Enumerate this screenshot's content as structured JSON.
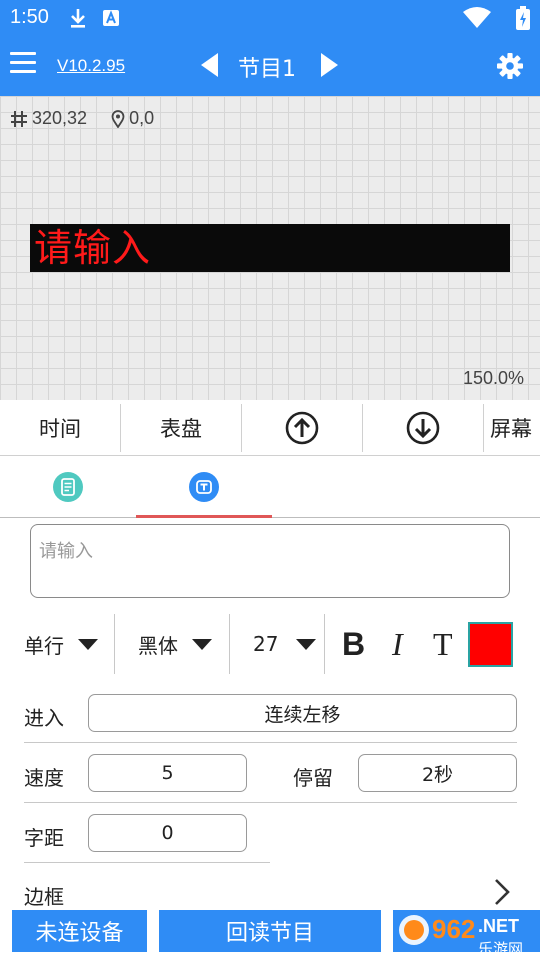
{
  "status_bar": {
    "time": "1:50"
  },
  "app_bar": {
    "version": "V10.2.95",
    "program_title": "节目1"
  },
  "canvas": {
    "coord_size": "320,32",
    "coord_position": "0,0",
    "led_text": "请输入",
    "zoom": "150.0%",
    "led_text_color": "#ff1a1a",
    "led_bg_color": "#0a0a0a"
  },
  "toolbar": {
    "time_label": "时间",
    "dial_label": "表盘",
    "screen_label": "屏幕"
  },
  "text_input": {
    "placeholder": "请输入"
  },
  "format": {
    "line_mode": "单行",
    "font": "黑体",
    "size": "27",
    "bold": "B",
    "italic": "I",
    "text_style": "T",
    "text_color": "#ff0000"
  },
  "settings": {
    "enter_label": "进入",
    "enter_value": "连续左移",
    "speed_label": "速度",
    "speed_value": "5",
    "stay_label": "停留",
    "stay_value": "2秒",
    "spacing_label": "字距",
    "spacing_value": "0",
    "border_label": "边框"
  },
  "bottom_buttons": {
    "disconnected": "未连设备",
    "readback": "回读节目"
  },
  "watermark": {
    "brand": "962",
    "suffix": ".NET",
    "subtitle": "乐游网"
  },
  "accent_color": "#2f8cf5"
}
